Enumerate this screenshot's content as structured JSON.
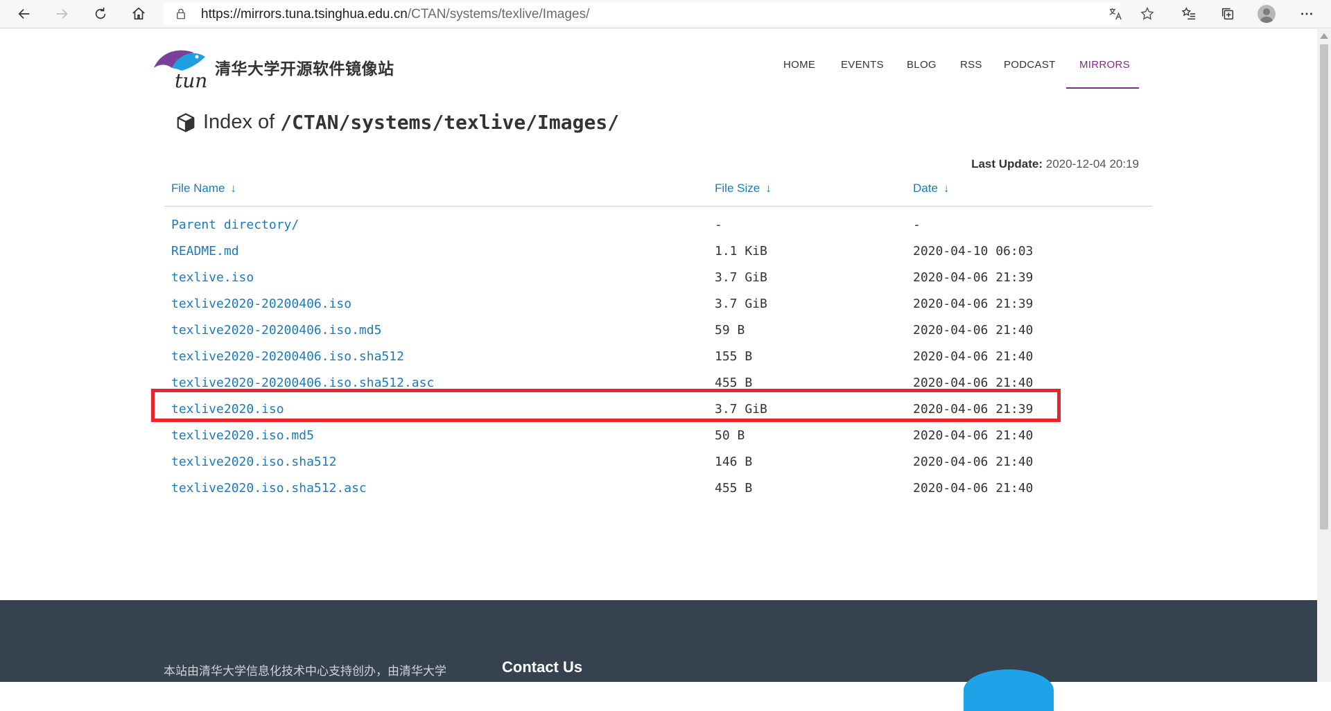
{
  "browser": {
    "url_host": "https://mirrors.tuna.tsinghua.edu.cn",
    "url_path": "/CTAN/systems/texlive/Images/"
  },
  "header": {
    "site_title": "清华大学开源软件镜像站",
    "logo_text": "tuna",
    "nav": [
      {
        "label": "HOME"
      },
      {
        "label": "EVENTS"
      },
      {
        "label": "BLOG"
      },
      {
        "label": "RSS"
      },
      {
        "label": "PODCAST"
      },
      {
        "label": "MIRRORS",
        "active": true
      }
    ]
  },
  "content": {
    "title_prefix": "Index of",
    "title_path": "/CTAN/systems/texlive/Images/",
    "last_update_label": "Last Update:",
    "last_update_value": "2020-12-04 20:19",
    "columns": {
      "name": "File Name",
      "size": "File Size",
      "date": "Date",
      "sort_arrow": "↓"
    },
    "files": [
      {
        "name": "Parent directory/",
        "size": "-",
        "date": "-"
      },
      {
        "name": "README.md",
        "size": "1.1 KiB",
        "date": "2020-04-10 06:03"
      },
      {
        "name": "texlive.iso",
        "size": "3.7 GiB",
        "date": "2020-04-06 21:39"
      },
      {
        "name": "texlive2020-20200406.iso",
        "size": "3.7 GiB",
        "date": "2020-04-06 21:39"
      },
      {
        "name": "texlive2020-20200406.iso.md5",
        "size": "59 B",
        "date": "2020-04-06 21:40"
      },
      {
        "name": "texlive2020-20200406.iso.sha512",
        "size": "155 B",
        "date": "2020-04-06 21:40"
      },
      {
        "name": "texlive2020-20200406.iso.sha512.asc",
        "size": "455 B",
        "date": "2020-04-06 21:40"
      },
      {
        "name": "texlive2020.iso",
        "size": "3.7 GiB",
        "date": "2020-04-06 21:39"
      },
      {
        "name": "texlive2020.iso.md5",
        "size": "50 B",
        "date": "2020-04-06 21:40"
      },
      {
        "name": "texlive2020.iso.sha512",
        "size": "146 B",
        "date": "2020-04-06 21:40"
      },
      {
        "name": "texlive2020.iso.sha512.asc",
        "size": "455 B",
        "date": "2020-04-06 21:40"
      }
    ]
  },
  "footer": {
    "text": "本站由清华大学信息化技术中心支持创办，由清华大学",
    "contact_heading": "Contact Us"
  },
  "colors": {
    "link": "#1d7ab8",
    "accent": "#7b2d86",
    "highlight": "#e8242c",
    "footer_bg": "#374250"
  }
}
